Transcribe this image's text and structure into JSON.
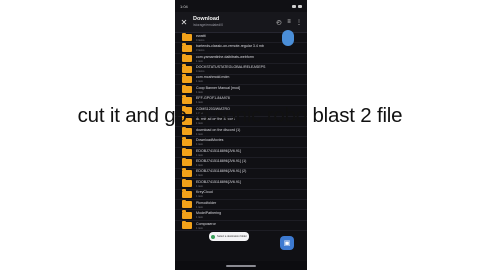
{
  "status_bar": {
    "time": "1:04"
  },
  "toolbar": {
    "title": "Download",
    "path": "/storage/emulated/0",
    "close_icon": "close-icon",
    "icons": [
      "history-icon",
      "sort-icon",
      "more-icon"
    ]
  },
  "files": [
    {
      "name": "ewattt",
      "sub": "4 items"
    },
    {
      "name": "bartends-classic-on-remote-regular 3.4 mb",
      "sub": "3 items"
    },
    {
      "name": "com.yamamtinhe.daibitrats-webform",
      "sub": "1 item"
    },
    {
      "name": "DOCKSTATUSTATEGLOBAL/RELEASEPS",
      "sub": "4 items"
    },
    {
      "name": "com.mcahmoid.mdm",
      "sub": "1 item"
    },
    {
      "name": "Coop Banner Manual [mod]",
      "sub": "1 item"
    },
    {
      "name": "EFF-GPOF1-84A978",
      "sub": "1 item"
    },
    {
      "name": "COMS1203/WIATRO",
      "sub": "1 item"
    },
    {
      "name": "download on the discord",
      "sub": "1 item"
    },
    {
      "name": "download on the discord (1)",
      "sub": "1 item"
    },
    {
      "name": "DownloadMovies",
      "sub": "1 item"
    },
    {
      "name": "EDOBJ7415118896[JV6.91]",
      "sub": "1 item"
    },
    {
      "name": "EDOBJ7415118896[JV6.91] (1)",
      "sub": "1 item"
    },
    {
      "name": "EDOBJ7415118896[JV6.91] (2)",
      "sub": "1 item"
    },
    {
      "name": "EDOBJ7415118896[JV6.91]",
      "sub": "1 item"
    },
    {
      "name": "KreyCloud",
      "sub": "1 item"
    },
    {
      "name": "Pkmodfolder",
      "sub": "1 item"
    },
    {
      "name": "ModelPathering",
      "sub": "1 item"
    },
    {
      "name": "Composeror",
      "sub": "1 item"
    }
  ],
  "snackbar": {
    "text": "Select a destination folder"
  },
  "caption": "cut it and go to sonic robo blast 2 file"
}
